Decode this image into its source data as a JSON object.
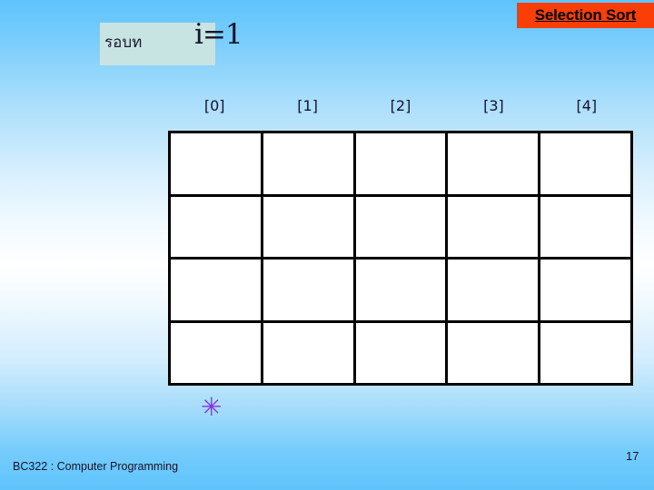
{
  "slide": {
    "title": "Selection Sort",
    "title_banner_color": "#f93f07",
    "background_top_color": "#5fc4fc",
    "background_mid_color": "#ffffff"
  },
  "round": {
    "label": "รอบท",
    "expression": "i=1",
    "highlight_color": "#c7e4e3"
  },
  "array": {
    "headers": [
      "[0]",
      "[1]",
      "[2]",
      "[3]",
      "[4]"
    ],
    "rows": [
      [
        "",
        "",
        "",
        "",
        ""
      ],
      [
        "",
        "",
        "",
        "",
        ""
      ],
      [
        "",
        "",
        "",
        "",
        ""
      ],
      [
        "",
        "",
        "",
        "",
        ""
      ]
    ]
  },
  "marker": {
    "symbol": "✳",
    "color": "#8833dd"
  },
  "footer": {
    "course": "BC322 : Computer Programming",
    "page_number": "17"
  }
}
